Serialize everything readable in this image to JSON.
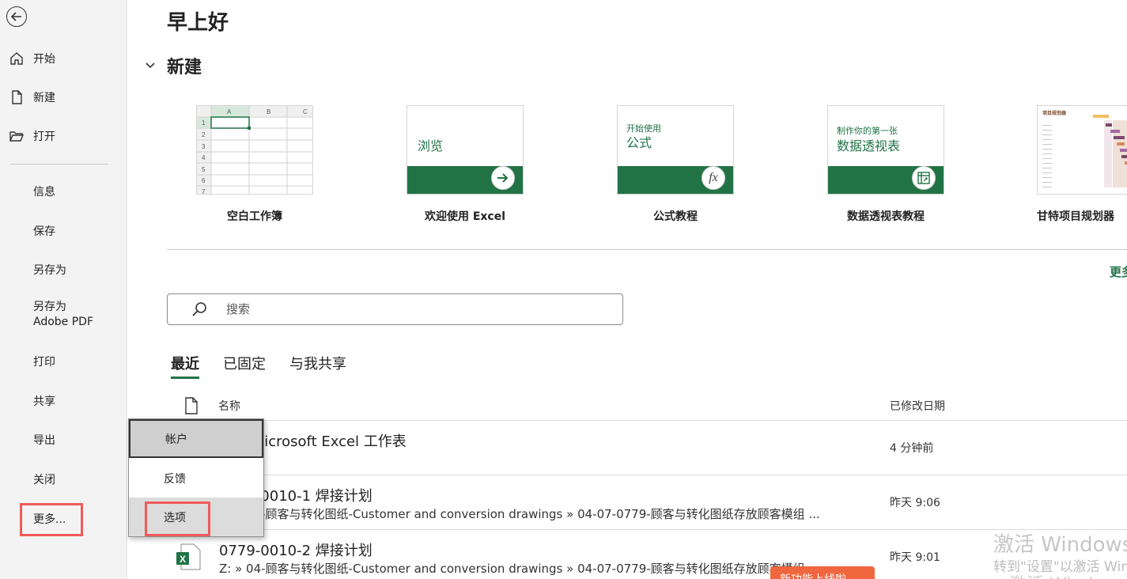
{
  "sidebar": {
    "primary": [
      {
        "label": "开始",
        "icon": "home-icon"
      },
      {
        "label": "新建",
        "icon": "new-file-icon"
      },
      {
        "label": "打开",
        "icon": "folder-open-icon"
      }
    ],
    "secondary": [
      "信息",
      "保存",
      "另存为",
      "另存为\nAdobe PDF",
      "打印",
      "共享",
      "导出",
      "关闭"
    ],
    "more_label": "更多..."
  },
  "main": {
    "greeting": "早上好",
    "new_section_title": "新建",
    "templates": [
      {
        "name": "空白工作簿"
      },
      {
        "name": "欢迎使用 Excel",
        "card_text": "浏览"
      },
      {
        "name": "公式教程",
        "card_small": "开始使用",
        "card_big": "公式",
        "icon_text": "fx"
      },
      {
        "name": "数据透视表教程",
        "card_small": "制作你的第一张",
        "card_big": "数据透视表"
      },
      {
        "name": "甘特项目规划器",
        "card_small": "项目规划器"
      }
    ],
    "more_templates": "更多",
    "sheet_cols": [
      "A",
      "B",
      "C"
    ],
    "sheet_rows": [
      "1",
      "2",
      "3",
      "4",
      "5",
      "6",
      "7"
    ],
    "search_placeholder": "搜索",
    "tabs": [
      "最近",
      "已固定",
      "与我共享"
    ],
    "list_headers": {
      "name": "名称",
      "modified": "已修改日期"
    },
    "files": [
      {
        "title": "新建 Microsoft Excel 工作表",
        "path": "",
        "modified": "4 分钟前"
      },
      {
        "title": "0779-0010-1 焊接计划",
        "path": "Z: » 04-顾客与转化图纸-Customer and conversion drawings » 04-07-0779-顾客与转化图纸存放顾客模组 ...",
        "modified": "昨天 9:06"
      },
      {
        "title": "0779-0010-2 焊接计划",
        "path": "Z: » 04-顾客与转化图纸-Customer and conversion drawings » 04-07-0779-顾客与转化图纸存放顾客模组 ...",
        "modified": "昨天 9:01"
      }
    ]
  },
  "popup_menu": {
    "items": [
      "帐户",
      "反馈",
      "选项"
    ]
  },
  "watermark": {
    "line1": "激活 Windows",
    "line2": "转到\"设置\"以激活 Windows。",
    "line3": "激活 Windows"
  },
  "toast": {
    "text": "新功能上线啦"
  },
  "colors": {
    "accent": "#217346",
    "highlight": "#f05a5a"
  }
}
